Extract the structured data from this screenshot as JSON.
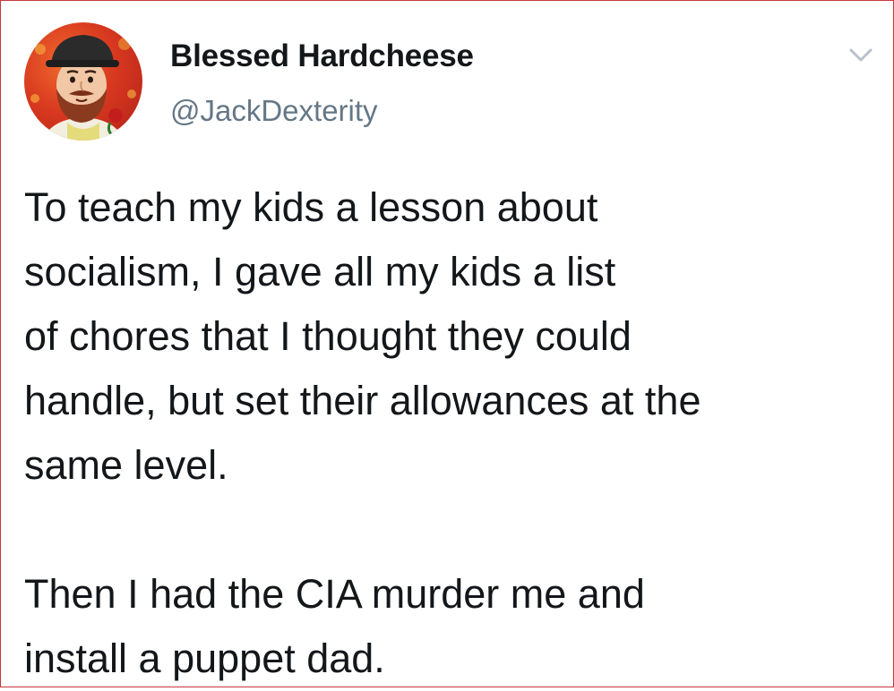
{
  "tweet": {
    "author": {
      "display_name": "Blessed Hardcheese",
      "handle": "@JackDexterity"
    },
    "body": [
      "To teach my kids a lesson about\nsocialism, I gave all my kids a list\nof chores that I thought they could\nhandle, but set their allowances at the\nsame level.",
      "Then I had the CIA murder me and\ninstall a puppet dad."
    ],
    "menu_icon": "chevron-down-icon"
  },
  "colors": {
    "border": "#c7373a",
    "text": "#14171a",
    "secondary_text": "#657786",
    "avatar_background": "#d8391f"
  }
}
